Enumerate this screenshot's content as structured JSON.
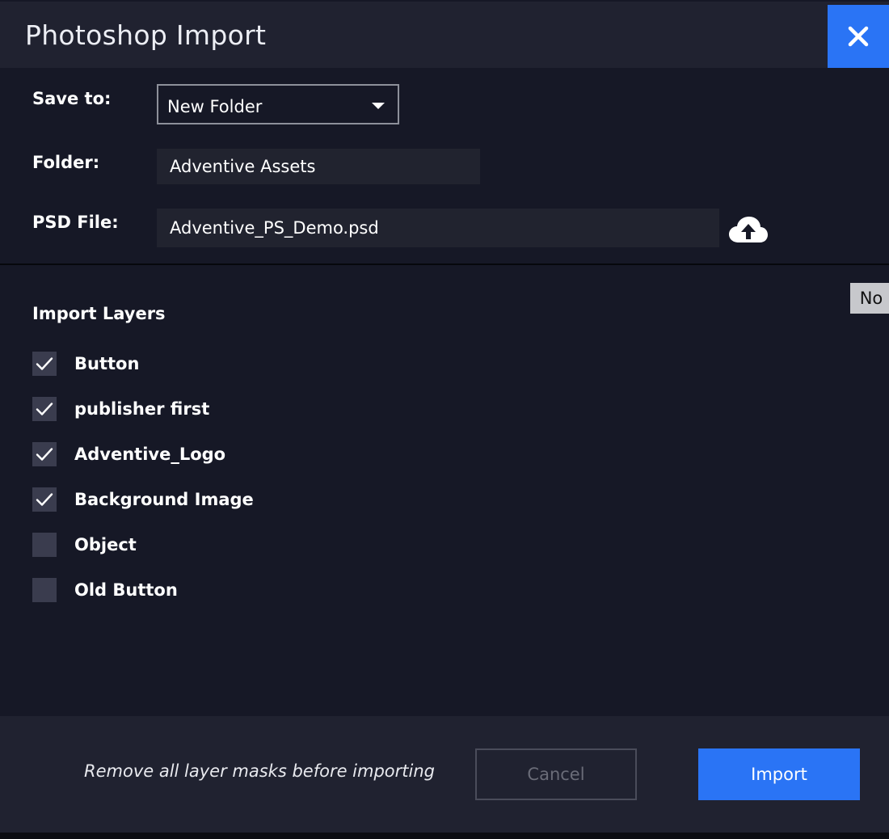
{
  "dialog": {
    "title": "Photoshop Import",
    "close_icon": "close-icon"
  },
  "form": {
    "save_to_label": "Save to:",
    "save_to_value": "New Folder",
    "folder_label": "Folder:",
    "folder_value": "Adventive Assets",
    "psd_label": "PSD File:",
    "psd_value": "Adventive_PS_Demo.psd",
    "upload_icon": "cloud-upload-icon"
  },
  "side_tab": {
    "label": "No"
  },
  "layers": {
    "title": "Import Layers",
    "items": [
      {
        "label": "Button",
        "checked": true
      },
      {
        "label": "publisher first",
        "checked": true
      },
      {
        "label": "Adventive_Logo",
        "checked": true
      },
      {
        "label": "Background Image",
        "checked": true
      },
      {
        "label": "Object",
        "checked": false
      },
      {
        "label": "Old Button",
        "checked": false
      }
    ]
  },
  "footer": {
    "note": "Remove all layer masks before importing",
    "cancel_label": "Cancel",
    "import_label": "Import"
  },
  "colors": {
    "accent": "#2a74f5",
    "background": "#161826",
    "panel": "#202230"
  }
}
